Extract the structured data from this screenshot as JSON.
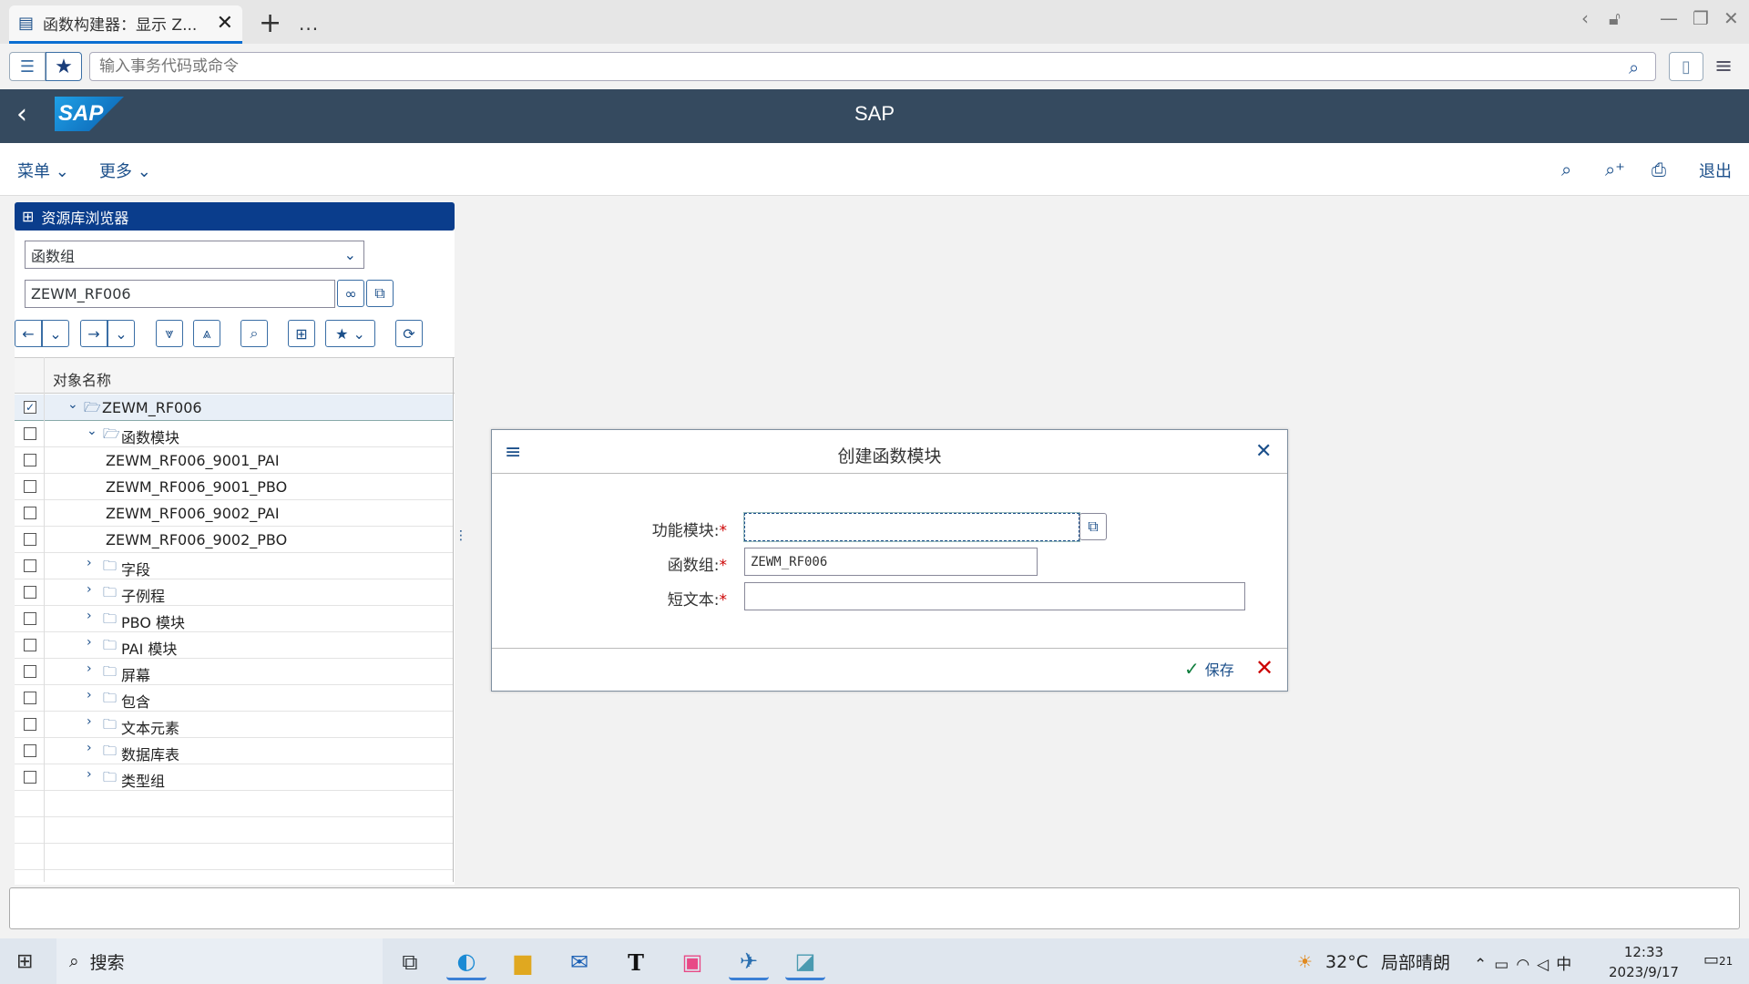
{
  "browser": {
    "tab_title": "函数构建器：显示 Z...",
    "new_tab": "+",
    "more_tabs": "...",
    "command_placeholder": "输入事务代码或命令"
  },
  "shell": {
    "logo": "SAP",
    "title": "SAP"
  },
  "toolbar": {
    "menu": "菜单",
    "more": "更多",
    "exit": "退出"
  },
  "repo": {
    "header": "资源库浏览器",
    "object_type": "函数组",
    "object_name": "ZEWM_RF006",
    "column_header": "对象名称",
    "tree": [
      {
        "label": "ZEWM_RF006",
        "level": 0,
        "expanded": true,
        "folder": true,
        "checked": true,
        "selected": true
      },
      {
        "label": "函数模块",
        "level": 1,
        "expanded": true,
        "folder": true,
        "checked": false
      },
      {
        "label": "ZEWM_RF006_9001_PAI",
        "level": 2,
        "leaf": true,
        "checked": false
      },
      {
        "label": "ZEWM_RF006_9001_PBO",
        "level": 2,
        "leaf": true,
        "checked": false
      },
      {
        "label": "ZEWM_RF006_9002_PAI",
        "level": 2,
        "leaf": true,
        "checked": false
      },
      {
        "label": "ZEWM_RF006_9002_PBO",
        "level": 2,
        "leaf": true,
        "checked": false
      },
      {
        "label": "字段",
        "level": 1,
        "expanded": false,
        "folder": true,
        "checked": false
      },
      {
        "label": "子例程",
        "level": 1,
        "expanded": false,
        "folder": true,
        "checked": false
      },
      {
        "label": "PBO 模块",
        "level": 1,
        "expanded": false,
        "folder": true,
        "checked": false
      },
      {
        "label": "PAI 模块",
        "level": 1,
        "expanded": false,
        "folder": true,
        "checked": false
      },
      {
        "label": "屏幕",
        "level": 1,
        "expanded": false,
        "folder": true,
        "checked": false
      },
      {
        "label": "包含",
        "level": 1,
        "expanded": false,
        "folder": true,
        "checked": false
      },
      {
        "label": "文本元素",
        "level": 1,
        "expanded": false,
        "folder": true,
        "checked": false
      },
      {
        "label": "数据库表",
        "level": 1,
        "expanded": false,
        "folder": true,
        "checked": false
      },
      {
        "label": "类型组",
        "level": 1,
        "expanded": false,
        "folder": true,
        "checked": false
      }
    ]
  },
  "dialog": {
    "title": "创建函数模块",
    "function_module_label": "功能模块:",
    "function_module_value": "",
    "function_group_label": "函数组:",
    "function_group_value": "ZEWM_RF006",
    "short_text_label": "短文本:",
    "short_text_value": "",
    "required_marker": "*",
    "save": "保存"
  },
  "taskbar": {
    "search": "搜索",
    "temperature": "32°C",
    "weather": "局部晴朗",
    "ime": "中",
    "time": "12:33",
    "date": "2023/9/17",
    "notifications": "21"
  },
  "colors": {
    "shell": "#354a5f",
    "accent": "#1b4f8a",
    "repo_header": "#0a3d8c",
    "required": "#cc0000",
    "save_check": "#107e3e"
  }
}
